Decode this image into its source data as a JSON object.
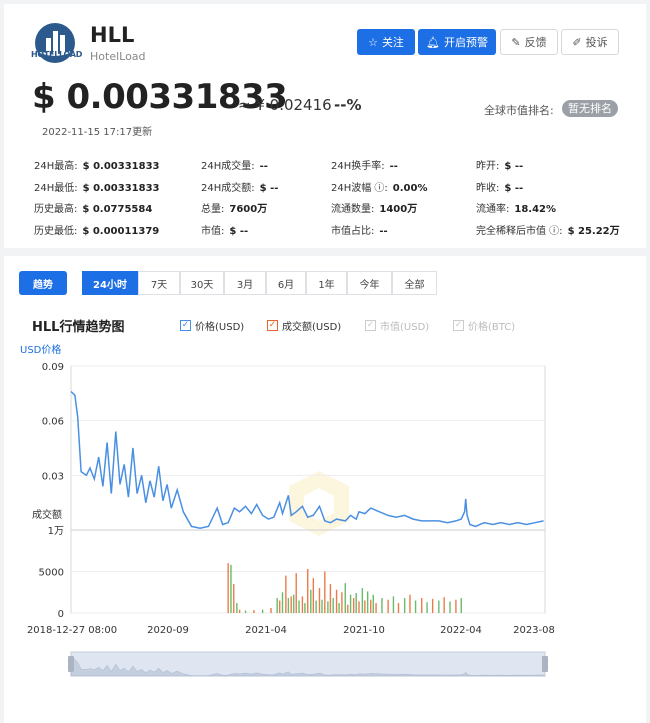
{
  "coin": {
    "symbol": "HLL",
    "name": "HotelLoad",
    "logo_text": "HOTELLOAD",
    "price_usd": "$ 0.00331833",
    "price_cny": "≈ ¥ 0.02416",
    "change": "--%",
    "update_time": "2022-11-15 17:17更新",
    "rank_label": "全球市值排名:",
    "rank_value": "暂无排名"
  },
  "actions": {
    "follow": "关注",
    "alert": "开启预警",
    "feedback": "反馈",
    "report": "投诉"
  },
  "stats": [
    [
      {
        "label": "24H最高:",
        "value": "$ 0.00331833"
      },
      {
        "label": "24H成交量:",
        "value": "--"
      },
      {
        "label": "24H换手率:",
        "value": "--"
      },
      {
        "label": "昨开:",
        "value": "$ --"
      }
    ],
    [
      {
        "label": "24H最低:",
        "value": "$ 0.00331833"
      },
      {
        "label": "24H成交额:",
        "value": "$ --"
      },
      {
        "label": "24H波幅 ⓘ:",
        "value": "0.00%"
      },
      {
        "label": "昨收:",
        "value": "$ --"
      }
    ],
    [
      {
        "label": "历史最高:",
        "value": "$ 0.0775584"
      },
      {
        "label": "总量:",
        "value": "7600万"
      },
      {
        "label": "流通数量:",
        "value": "1400万"
      },
      {
        "label": "流通率:",
        "value": "18.42%"
      }
    ],
    [
      {
        "label": "历史最低:",
        "value": "$ 0.00011379"
      },
      {
        "label": "市值:",
        "value": "$ --"
      },
      {
        "label": "市值占比:",
        "value": "--"
      },
      {
        "label": "完全稀释后市值 ⓘ:",
        "value": "$ 25.22万"
      }
    ]
  ],
  "tabs": {
    "trend": "趋势",
    "ranges": [
      "24小时",
      "7天",
      "30天",
      "3月",
      "6月",
      "1年",
      "今年",
      "全部"
    ],
    "active_index": 0
  },
  "chart_data": {
    "type": "line",
    "title": "HLL行情趋势图",
    "legend": [
      {
        "name": "价格(USD)",
        "checked": true,
        "color": "#4a90e2"
      },
      {
        "name": "成交额(USD)",
        "checked": true,
        "color": "#e8642a"
      },
      {
        "name": "市值(USD)",
        "checked": false,
        "color": "#cccccc"
      },
      {
        "name": "价格(BTC)",
        "checked": false,
        "color": "#cccccc"
      }
    ],
    "price_axis": {
      "label": "USD价格",
      "ticks": [
        "0.09",
        "0.06",
        "0.03"
      ],
      "ylim": [
        0,
        0.09
      ]
    },
    "volume_axis": {
      "label": "成交额",
      "ticks": [
        "1万",
        "5000",
        "0"
      ],
      "ylim": [
        0,
        10000
      ]
    },
    "x_ticks": [
      "2018-12-27 08:00",
      "2020-09",
      "2021-04",
      "2021-10",
      "2022-04",
      "2023-08"
    ],
    "price_series": [
      [
        "2018-12-27",
        0.076
      ],
      [
        "2019-01-10",
        0.074
      ],
      [
        "2019-01-20",
        0.062
      ],
      [
        "2019-02-01",
        0.032
      ],
      [
        "2019-02-20",
        0.03
      ],
      [
        "2019-03-05",
        0.034
      ],
      [
        "2019-03-20",
        0.028
      ],
      [
        "2019-04-05",
        0.04
      ],
      [
        "2019-04-20",
        0.024
      ],
      [
        "2019-05-05",
        0.048
      ],
      [
        "2019-05-20",
        0.02
      ],
      [
        "2019-06-05",
        0.054
      ],
      [
        "2019-06-20",
        0.025
      ],
      [
        "2019-07-05",
        0.036
      ],
      [
        "2019-07-20",
        0.018
      ],
      [
        "2019-08-05",
        0.045
      ],
      [
        "2019-08-20",
        0.02
      ],
      [
        "2019-09-05",
        0.03
      ],
      [
        "2019-09-20",
        0.015
      ],
      [
        "2019-10-05",
        0.027
      ],
      [
        "2019-10-20",
        0.018
      ],
      [
        "2019-11-05",
        0.035
      ],
      [
        "2019-11-20",
        0.016
      ],
      [
        "2019-12-05",
        0.025
      ],
      [
        "2019-12-20",
        0.012
      ],
      [
        "2020-01-10",
        0.022
      ],
      [
        "2020-02-01",
        0.01
      ],
      [
        "2020-03-01",
        0.002
      ],
      [
        "2020-04-01",
        0.001
      ],
      [
        "2020-05-01",
        0.002
      ],
      [
        "2020-06-01",
        0.012
      ],
      [
        "2020-06-20",
        0.003
      ],
      [
        "2020-07-10",
        0.004
      ],
      [
        "2020-08-01",
        0.012
      ],
      [
        "2020-08-20",
        0.01
      ],
      [
        "2020-09-10",
        0.013
      ],
      [
        "2020-10-01",
        0.009
      ],
      [
        "2020-10-20",
        0.014
      ],
      [
        "2020-11-10",
        0.008
      ],
      [
        "2020-12-01",
        0.006
      ],
      [
        "2020-12-20",
        0.007
      ],
      [
        "2021-01-10",
        0.015
      ],
      [
        "2021-01-20",
        0.009
      ],
      [
        "2021-02-10",
        0.019
      ],
      [
        "2021-02-20",
        0.008
      ],
      [
        "2021-03-10",
        0.01
      ],
      [
        "2021-04-01",
        0.013
      ],
      [
        "2021-04-20",
        0.007
      ],
      [
        "2021-05-10",
        0.008
      ],
      [
        "2021-06-01",
        0.013
      ],
      [
        "2021-06-20",
        0.005
      ],
      [
        "2021-07-10",
        0.004
      ],
      [
        "2021-08-01",
        0.006
      ],
      [
        "2021-09-01",
        0.005
      ],
      [
        "2021-09-20",
        0.008
      ],
      [
        "2021-10-10",
        0.006
      ],
      [
        "2021-10-20",
        0.01
      ],
      [
        "2021-11-10",
        0.009
      ],
      [
        "2021-12-01",
        0.012
      ],
      [
        "2022-01-01",
        0.01
      ],
      [
        "2022-02-01",
        0.008
      ],
      [
        "2022-03-01",
        0.007
      ],
      [
        "2022-04-01",
        0.008
      ],
      [
        "2022-05-01",
        0.006
      ],
      [
        "2022-06-01",
        0.005
      ],
      [
        "2022-07-01",
        0.005
      ],
      [
        "2022-08-01",
        0.005
      ],
      [
        "2022-09-01",
        0.004
      ],
      [
        "2022-10-01",
        0.005
      ],
      [
        "2022-10-20",
        0.006
      ],
      [
        "2022-11-01",
        0.01
      ],
      [
        "2022-11-05",
        0.017
      ],
      [
        "2022-11-10",
        0.008
      ],
      [
        "2022-11-20",
        0.003
      ],
      [
        "2022-12-10",
        0.002
      ],
      [
        "2023-01-10",
        0.004
      ],
      [
        "2023-02-10",
        0.003
      ],
      [
        "2023-03-10",
        0.004
      ],
      [
        "2023-04-10",
        0.003
      ],
      [
        "2023-05-10",
        0.004
      ],
      [
        "2023-06-10",
        0.003
      ],
      [
        "2023-07-10",
        0.004
      ],
      [
        "2023-08-10",
        0.005
      ]
    ],
    "volume_series": [
      [
        "2020-07-10",
        6000
      ],
      [
        "2020-07-20",
        5800
      ],
      [
        "2020-07-30",
        3500
      ],
      [
        "2020-08-10",
        1200
      ],
      [
        "2020-08-20",
        400
      ],
      [
        "2020-09-10",
        300
      ],
      [
        "2020-10-10",
        350
      ],
      [
        "2020-11-10",
        400
      ],
      [
        "2020-12-10",
        600
      ],
      [
        "2021-01-01",
        1800
      ],
      [
        "2021-01-10",
        1500
      ],
      [
        "2021-01-20",
        2500
      ],
      [
        "2021-02-01",
        4500
      ],
      [
        "2021-02-10",
        1800
      ],
      [
        "2021-02-20",
        2000
      ],
      [
        "2021-03-01",
        2200
      ],
      [
        "2021-03-10",
        4800
      ],
      [
        "2021-03-20",
        1500
      ],
      [
        "2021-04-01",
        2000
      ],
      [
        "2021-04-10",
        1200
      ],
      [
        "2021-04-20",
        5300
      ],
      [
        "2021-05-01",
        2800
      ],
      [
        "2021-05-10",
        4200
      ],
      [
        "2021-05-20",
        1500
      ],
      [
        "2021-06-01",
        3000
      ],
      [
        "2021-06-10",
        1600
      ],
      [
        "2021-06-20",
        5000
      ],
      [
        "2021-07-01",
        1400
      ],
      [
        "2021-07-10",
        3500
      ],
      [
        "2021-07-20",
        1800
      ],
      [
        "2021-08-01",
        2800
      ],
      [
        "2021-08-10",
        1200
      ],
      [
        "2021-08-20",
        2500
      ],
      [
        "2021-09-01",
        3600
      ],
      [
        "2021-09-10",
        1000
      ],
      [
        "2021-09-20",
        2200
      ],
      [
        "2021-10-01",
        1800
      ],
      [
        "2021-10-10",
        2400
      ],
      [
        "2021-10-20",
        1400
      ],
      [
        "2021-11-01",
        3000
      ],
      [
        "2021-11-10",
        1500
      ],
      [
        "2021-11-20",
        2600
      ],
      [
        "2021-12-01",
        1600
      ],
      [
        "2021-12-10",
        2200
      ],
      [
        "2021-12-20",
        1200
      ],
      [
        "2022-01-10",
        1800
      ],
      [
        "2022-02-01",
        1600
      ],
      [
        "2022-02-20",
        2000
      ],
      [
        "2022-03-10",
        1200
      ],
      [
        "2022-04-01",
        1800
      ],
      [
        "2022-04-20",
        2200
      ],
      [
        "2022-05-10",
        1500
      ],
      [
        "2022-06-01",
        1800
      ],
      [
        "2022-06-20",
        1300
      ],
      [
        "2022-07-10",
        1700
      ],
      [
        "2022-08-01",
        1500
      ],
      [
        "2022-08-20",
        1900
      ],
      [
        "2022-09-10",
        1400
      ],
      [
        "2022-10-01",
        1600
      ],
      [
        "2022-10-20",
        1800
      ]
    ]
  }
}
